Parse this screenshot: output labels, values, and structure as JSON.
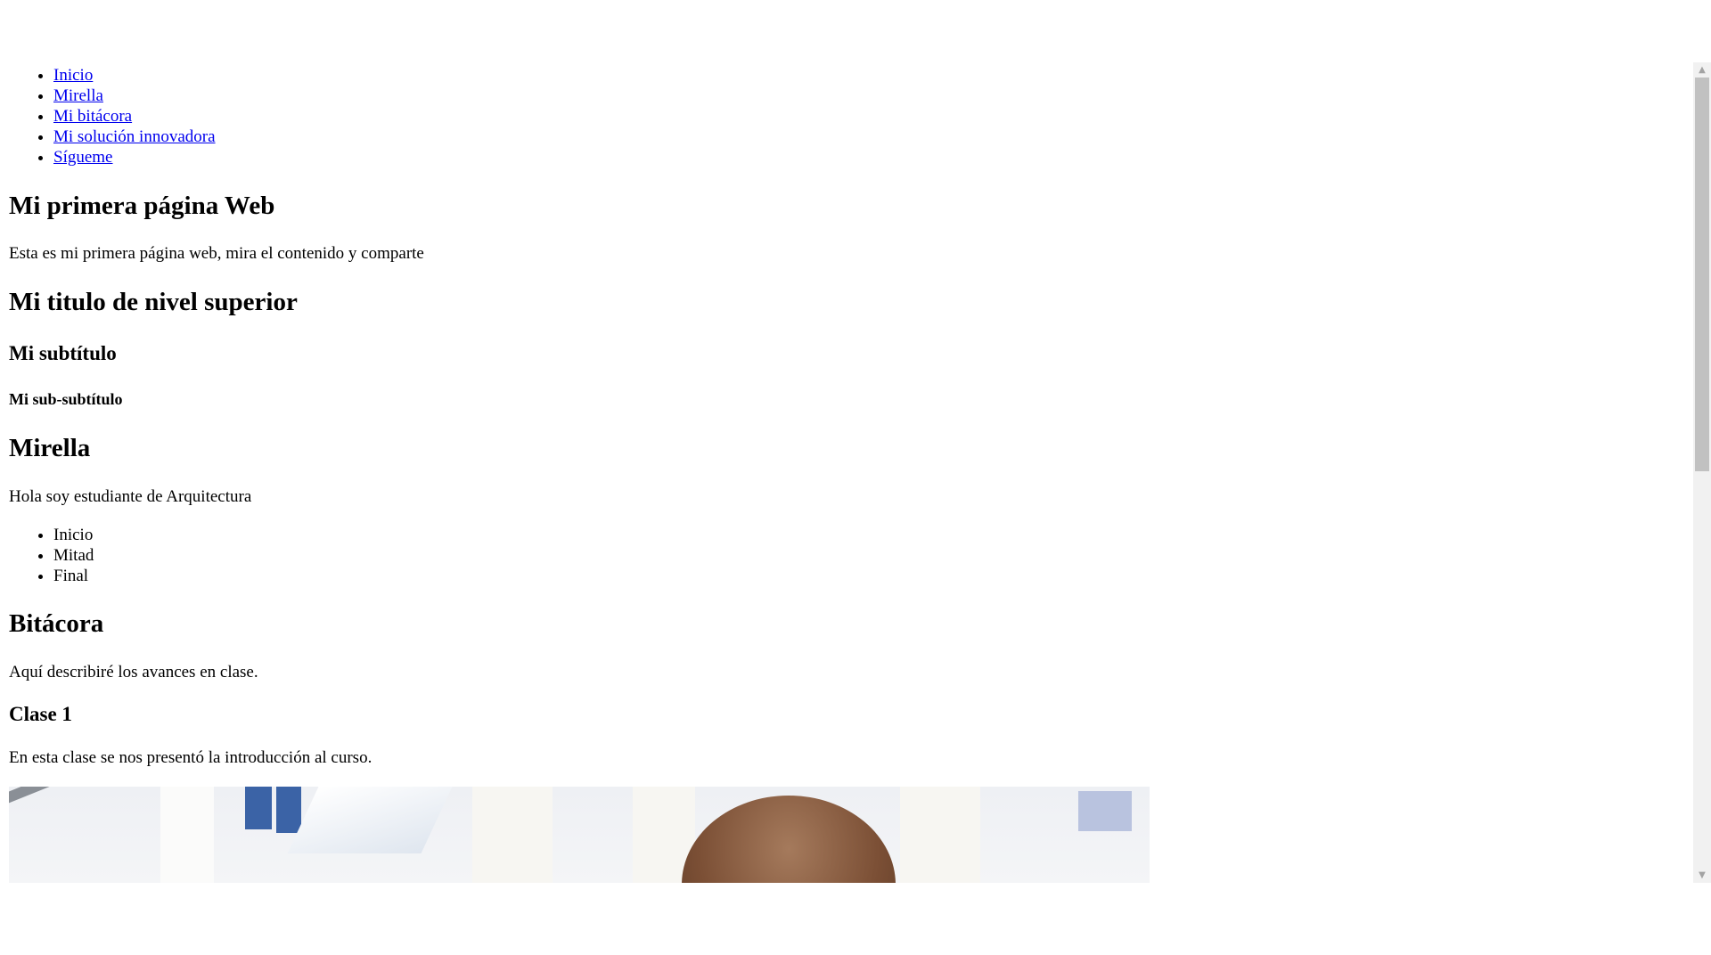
{
  "nav": {
    "items": [
      {
        "label": "Inicio"
      },
      {
        "label": "Mirella"
      },
      {
        "label": "Mi bitácora"
      },
      {
        "label": "Mi solución innovadora"
      },
      {
        "label": "Sígueme"
      }
    ]
  },
  "main": {
    "title": "Mi primera página Web",
    "intro": "Esta es mi primera página web, mira el contenido y comparte",
    "heading_superior": "Mi titulo de nivel superior",
    "subtitle": "Mi subtítulo",
    "sub_subtitle": "Mi sub-subtítulo"
  },
  "mirella": {
    "heading": "Mirella",
    "text": "Hola soy estudiante de Arquitectura",
    "list": [
      "Inicio",
      "Mitad",
      "Final"
    ]
  },
  "bitacora": {
    "heading": "Bitácora",
    "text": "Aquí describiré los avances en clase.",
    "clase1_heading": "Clase 1",
    "clase1_text": "En esta clase se nos presentó la introducción al curso."
  },
  "scrollbar": {
    "up_icon": "triangle-up",
    "down_icon": "triangle-down"
  },
  "colors": {
    "link": "#0000ee",
    "scroll_thumb": "#c1c1c1",
    "scroll_track": "#f1f1f1"
  }
}
